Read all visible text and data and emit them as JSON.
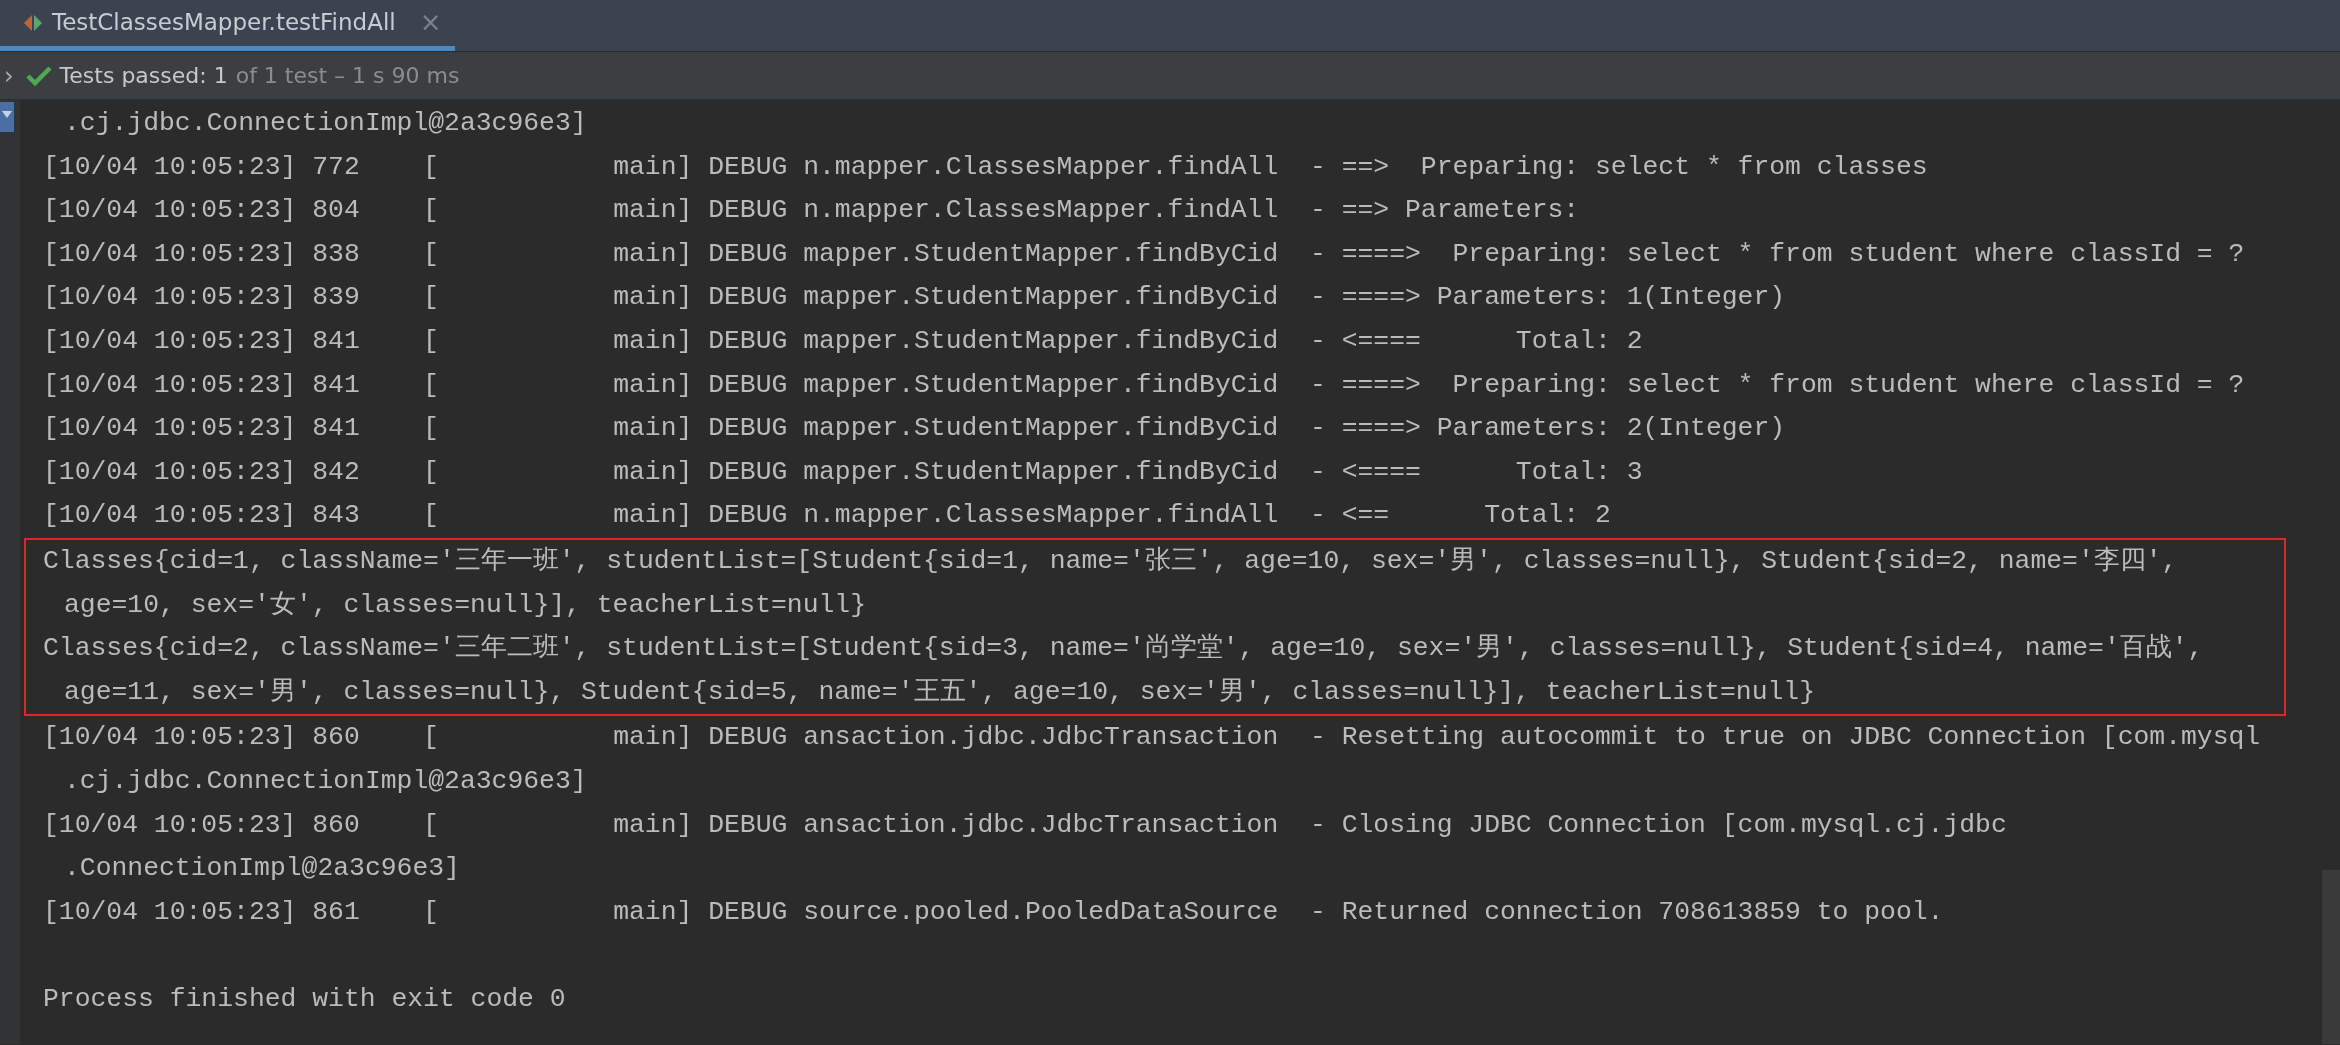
{
  "tab": {
    "title": "TestClassesMapper.testFindAll",
    "close": "×",
    "selected": true
  },
  "status_bar": {
    "expander": "›",
    "passed": "Tests passed: 1",
    "detail": "of 1 test – 1 s 90 ms"
  },
  "console": {
    "blocks": [
      {
        "kind": "plain",
        "lines": [
          {
            "text": ".cj.jdbc.ConnectionImpl@2a3c96e3]",
            "continuation": true
          },
          {
            "text": "[10/04 10:05:23] 772    [           main] DEBUG n.mapper.ClassesMapper.findAll  - ==>  Preparing: select * from classes",
            "continuation": false
          },
          {
            "text": "[10/04 10:05:23] 804    [           main] DEBUG n.mapper.ClassesMapper.findAll  - ==> Parameters: ",
            "continuation": false
          },
          {
            "text": "[10/04 10:05:23] 838    [           main] DEBUG mapper.StudentMapper.findByCid  - ====>  Preparing: select * from student where classId = ?",
            "continuation": false
          },
          {
            "text": "[10/04 10:05:23] 839    [           main] DEBUG mapper.StudentMapper.findByCid  - ====> Parameters: 1(Integer)",
            "continuation": false
          },
          {
            "text": "[10/04 10:05:23] 841    [           main] DEBUG mapper.StudentMapper.findByCid  - <====      Total: 2",
            "continuation": false
          },
          {
            "text": "[10/04 10:05:23] 841    [           main] DEBUG mapper.StudentMapper.findByCid  - ====>  Preparing: select * from student where classId = ?",
            "continuation": false
          },
          {
            "text": "[10/04 10:05:23] 841    [           main] DEBUG mapper.StudentMapper.findByCid  - ====> Parameters: 2(Integer)",
            "continuation": false
          },
          {
            "text": "[10/04 10:05:23] 842    [           main] DEBUG mapper.StudentMapper.findByCid  - <====      Total: 3",
            "continuation": false
          },
          {
            "text": "[10/04 10:05:23] 843    [           main] DEBUG n.mapper.ClassesMapper.findAll  - <==      Total: 2",
            "continuation": false
          }
        ]
      },
      {
        "kind": "boxed",
        "lines": [
          {
            "text": "Classes{cid=1, className='三年一班', studentList=[Student{sid=1, name='张三', age=10, sex='男', classes=null}, Student{sid=2, name='李四',",
            "continuation": false
          },
          {
            "text": "age=10, sex='女', classes=null}], teacherList=null}",
            "continuation": true
          },
          {
            "text": "Classes{cid=2, className='三年二班', studentList=[Student{sid=3, name='尚学堂', age=10, sex='男', classes=null}, Student{sid=4, name='百战',",
            "continuation": false
          },
          {
            "text": "age=11, sex='男', classes=null}, Student{sid=5, name='王五', age=10, sex='男', classes=null}], teacherList=null}",
            "continuation": true
          }
        ]
      },
      {
        "kind": "plain",
        "lines": [
          {
            "text": "[10/04 10:05:23] 860    [           main] DEBUG ansaction.jdbc.JdbcTransaction  - Resetting autocommit to true on JDBC Connection [com.mysql",
            "continuation": false
          },
          {
            "text": ".cj.jdbc.ConnectionImpl@2a3c96e3]",
            "continuation": true
          },
          {
            "text": "[10/04 10:05:23] 860    [           main] DEBUG ansaction.jdbc.JdbcTransaction  - Closing JDBC Connection [com.mysql.cj.jdbc",
            "continuation": false
          },
          {
            "text": ".ConnectionImpl@2a3c96e3]",
            "continuation": true
          },
          {
            "text": "[10/04 10:05:23] 861    [           main] DEBUG source.pooled.PooledDataSource  - Returned connection 708613859 to pool.",
            "continuation": false
          }
        ]
      },
      {
        "kind": "blank"
      },
      {
        "kind": "plain",
        "lines": [
          {
            "text": "Process finished with exit code 0",
            "continuation": false
          }
        ]
      }
    ]
  }
}
